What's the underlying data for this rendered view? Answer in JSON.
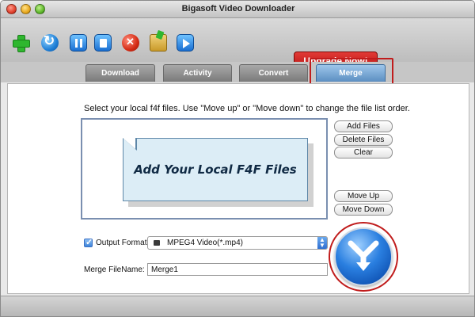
{
  "window": {
    "title": "Bigasoft Video Downloader"
  },
  "toolbar": {
    "icons": [
      "add-icon",
      "refresh-icon",
      "pause-icon",
      "stop-icon",
      "delete-icon",
      "open-folder-icon",
      "play-icon"
    ],
    "upgrade_label": "Upgrade Now!"
  },
  "tabs": [
    {
      "label": "Download"
    },
    {
      "label": "Activity"
    },
    {
      "label": "Convert"
    },
    {
      "label": "Merge",
      "active": true
    }
  ],
  "merge": {
    "instruction": "Select your local f4f files. Use \"Move up\" or \"Move down\" to change the file list order.",
    "placeholder": "Add Your Local F4F Files",
    "buttons": {
      "add_files": "Add Files",
      "delete_files": "Delete Files",
      "clear": "Clear",
      "move_up": "Move Up",
      "move_down": "Move Down"
    },
    "output_format": {
      "label": "Output Format:",
      "checked": true,
      "value": "MPEG4 Video(*.mp4)"
    },
    "file_name": {
      "label": "Merge FileName:",
      "value": "Merge1"
    }
  },
  "colors": {
    "accent": "#2a7fe0",
    "highlight": "#c01c1c",
    "upgrade": "#c81a16"
  }
}
